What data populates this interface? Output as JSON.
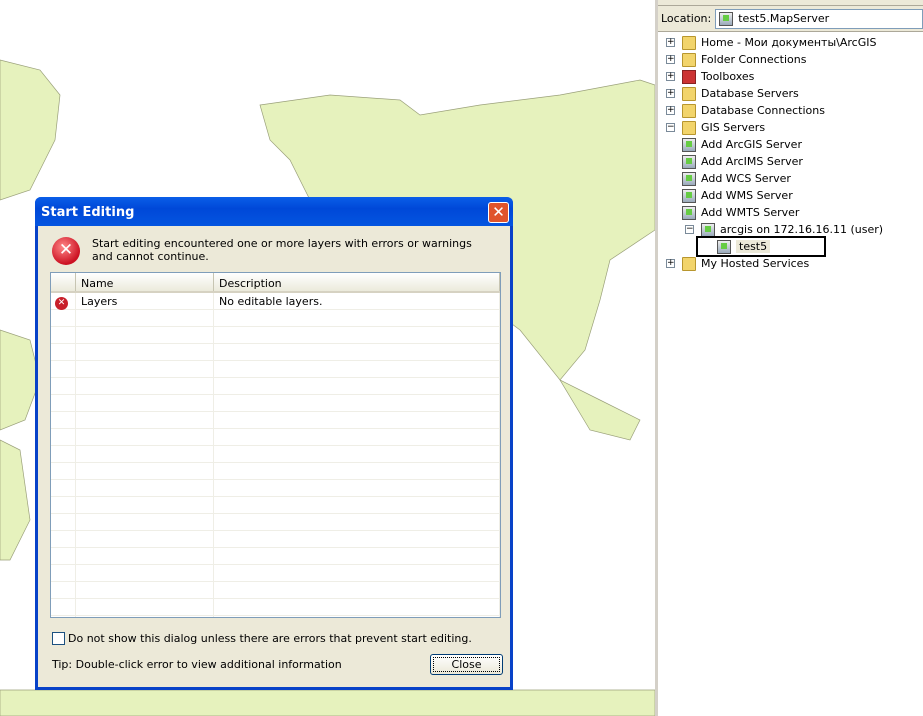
{
  "location": {
    "label": "Location:",
    "value": "test5.MapServer"
  },
  "tree": [
    {
      "label": "Home - Мои документы\\ArcGIS",
      "expander": "+",
      "icon": "home-folder-icon"
    },
    {
      "label": "Folder Connections",
      "expander": "+",
      "icon": "folder-connections-icon"
    },
    {
      "label": "Toolboxes",
      "expander": "+",
      "icon": "toolbox-icon"
    },
    {
      "label": "Database Servers",
      "expander": "+",
      "icon": "database-server-icon"
    },
    {
      "label": "Database Connections",
      "expander": "+",
      "icon": "database-connection-icon"
    },
    {
      "label": "GIS Servers",
      "expander": "−",
      "icon": "gis-servers-icon"
    },
    {
      "label": "Add ArcGIS Server",
      "icon": "add-server-icon"
    },
    {
      "label": "Add ArcIMS Server",
      "icon": "add-server-icon"
    },
    {
      "label": "Add WCS Server",
      "icon": "add-server-icon"
    },
    {
      "label": "Add WMS Server",
      "icon": "add-server-icon"
    },
    {
      "label": "Add WMTS Server",
      "icon": "add-server-icon"
    },
    {
      "label": "arcgis on 172.16.16.11 (user)",
      "expander": "−",
      "icon": "server-connection-icon"
    },
    {
      "label": "test5",
      "icon": "map-service-icon"
    },
    {
      "label": "My Hosted Services",
      "expander": "+",
      "icon": "hosted-services-icon"
    }
  ],
  "dialog": {
    "title": "Start Editing",
    "message": "Start editing encountered one or more layers with errors or warnings and cannot continue.",
    "columns": [
      "Name",
      "Description"
    ],
    "rows": [
      {
        "name": "Layers",
        "description": "No editable layers.",
        "status": "error"
      }
    ],
    "checkbox_label": "Do not show this dialog unless there are errors that prevent start editing.",
    "checkbox_checked": false,
    "tip": "Tip: Double-click error to view additional information",
    "close_label": "Close",
    "close_x": "✕",
    "error_glyph": "✕"
  },
  "colors": {
    "land": "#e6f2bd",
    "titlebar": "#0a5ee8",
    "selection": "#ece9d8"
  }
}
